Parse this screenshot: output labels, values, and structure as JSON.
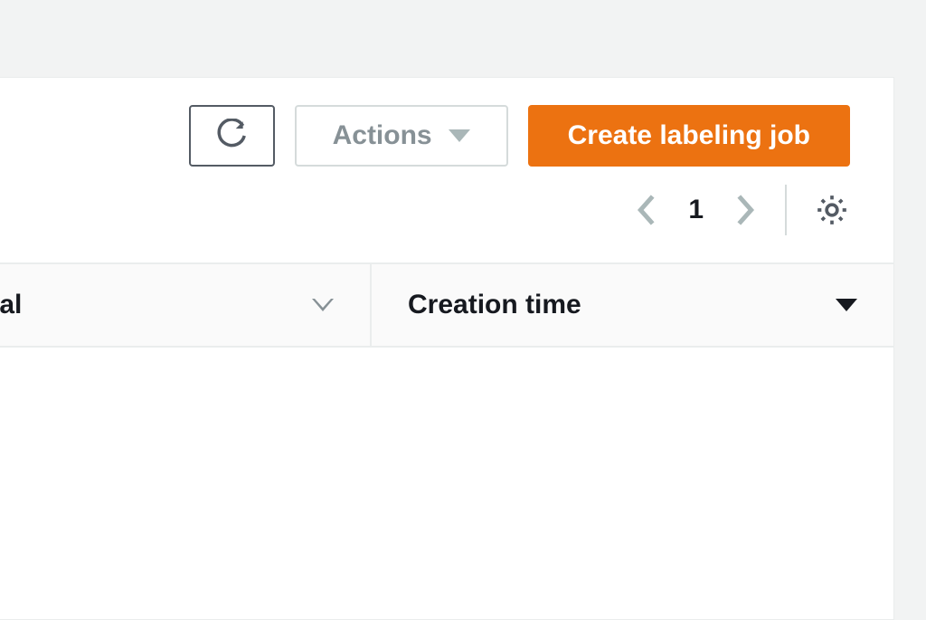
{
  "toolbar": {
    "actions_label": "Actions",
    "create_label": "Create labeling job"
  },
  "pagination": {
    "current_page": "1"
  },
  "table": {
    "columns": [
      {
        "label": "otal",
        "sorted": false
      },
      {
        "label": "Creation time",
        "sorted": true
      }
    ]
  }
}
